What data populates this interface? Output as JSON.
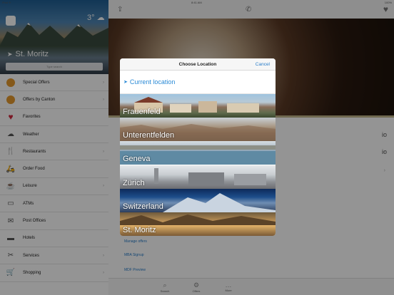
{
  "status": {
    "carrier": "iPad ✈",
    "time": "8:41 AM",
    "battery": "100%"
  },
  "sidebar": {
    "weather": "3° ☁",
    "location_name": "St. Moritz",
    "search_placeholder": "Type search",
    "items": [
      {
        "label": "Special Offers",
        "icon": "badge-orange-icon"
      },
      {
        "label": "Offers by Canton",
        "icon": "badge-orange-icon"
      },
      {
        "label": "Favorites",
        "icon": "heart-icon"
      },
      {
        "label": "Weather",
        "icon": "weather-icon"
      },
      {
        "label": "Restaurants",
        "icon": "cutlery-icon"
      },
      {
        "label": "Order Food",
        "icon": "delivery-icon"
      },
      {
        "label": "Leisure",
        "icon": "mug-icon"
      },
      {
        "label": "ATMs",
        "icon": "atm-icon"
      },
      {
        "label": "Post Offices",
        "icon": "mail-icon"
      },
      {
        "label": "Hotels",
        "icon": "bed-icon"
      },
      {
        "label": "Services",
        "icon": "tools-icon"
      },
      {
        "label": "Shopping",
        "icon": "cart-icon"
      }
    ]
  },
  "main": {
    "links": [
      "Manage offers",
      "MBA Signup",
      "MDF Preview"
    ],
    "tabs": [
      "Search",
      "Offers",
      "More"
    ]
  },
  "modal": {
    "title": "Choose Location",
    "cancel": "Cancel",
    "current_location": "Current location",
    "locations": [
      "Frauenfeld",
      "Unterentfelden",
      "Geneva",
      "Zürich",
      "Switzerland",
      "St. Moritz"
    ]
  },
  "colors": {
    "accent": "#2a8ad6",
    "badge": "#e69a2e",
    "favorite": "#d2283f"
  }
}
